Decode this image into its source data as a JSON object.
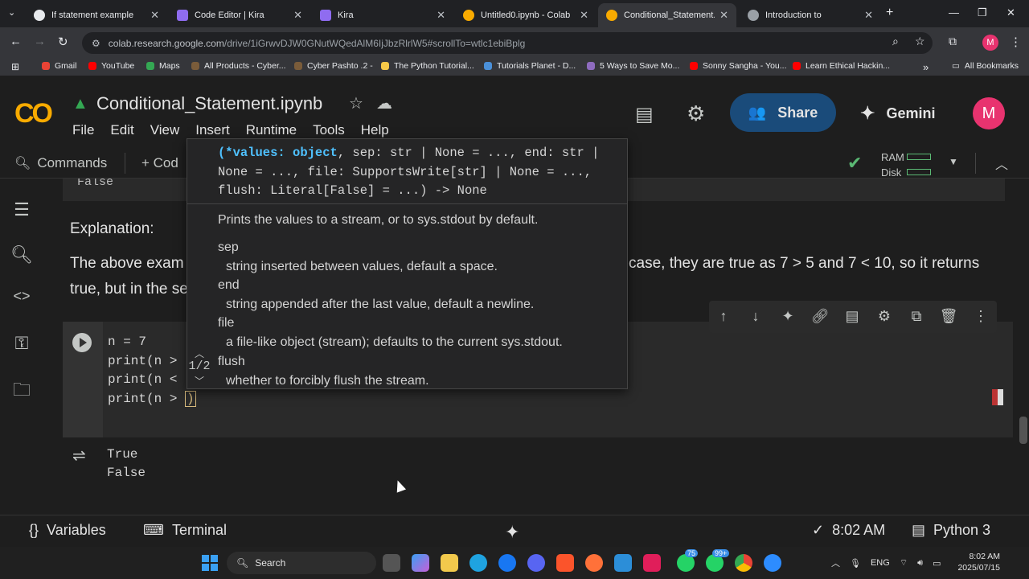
{
  "browser": {
    "tabs": [
      {
        "title": "If statement example",
        "icon": "chatgpt-icon",
        "color": "#e8eaed"
      },
      {
        "title": "Code Editor | Kira",
        "icon": "kira-icon",
        "color": "#8f6cf0"
      },
      {
        "title": "Kira",
        "icon": "kira-icon",
        "color": "#8f6cf0"
      },
      {
        "title": "Untitled0.ipynb - Colab",
        "icon": "colab-icon",
        "color": "#f9ab00"
      },
      {
        "title": "Conditional_Statement.ipyn",
        "icon": "colab-icon",
        "color": "#f9ab00"
      },
      {
        "title": "Introduction to",
        "icon": "globe-icon",
        "color": "#9aa0a6"
      }
    ],
    "new_tab": "+",
    "url_main": "colab.research.google.com",
    "url_tail": "/drive/1iGrwvDJW0GNutWQedAlM6IjJbzRlrlW5#scrollTo=wtlc1ebiBplg",
    "bookmarks": [
      {
        "label": "Gmail",
        "color": "#ea4335"
      },
      {
        "label": "YouTube",
        "color": "#ff0000"
      },
      {
        "label": "Maps",
        "color": "#34a853"
      },
      {
        "label": "All Products - Cyber...",
        "color": "#7a5c3a"
      },
      {
        "label": "Cyber Pashto .2 -",
        "color": "#7a5c3a"
      },
      {
        "label": "The Python Tutorial...",
        "color": "#f7c948"
      },
      {
        "label": "Tutorials Planet - D...",
        "color": "#4a90d9"
      },
      {
        "label": "5 Ways to Save Mo...",
        "color": "#8e6bbf"
      },
      {
        "label": "Sonny Sangha - You...",
        "color": "#ff0000"
      },
      {
        "label": "Learn Ethical Hackin...",
        "color": "#ff0000"
      }
    ],
    "bookmarks_more": "»",
    "all_bookmarks": "All Bookmarks"
  },
  "colab": {
    "logo": "CO",
    "notebook_title": "Conditional_Statement.ipynb",
    "menu": [
      "File",
      "Edit",
      "View",
      "Insert",
      "Runtime",
      "Tools",
      "Help"
    ],
    "share_label": "Share",
    "gemini_label": "Gemini",
    "avatar_letter": "M",
    "commands_label": "Commands",
    "add_code_label": "+ Cod",
    "ram_label": "RAM",
    "disk_label": "Disk"
  },
  "notebook": {
    "prev_output": "False",
    "explanation_heading": "Explanation:",
    "explanation_line1_start": "The above exam",
    "explanation_line1_end": "case, they are true as 7 > 5 and 7 < 10, so it returns",
    "explanation_line2": "true, but in the se",
    "code_lines": [
      "n = 7",
      "print(n >",
      "print(n <",
      "print(n > "
    ],
    "code_last_paren": ")",
    "output_lines": [
      "True",
      "False"
    ]
  },
  "tooltip": {
    "sig_line1_keyword": "(*values: object",
    "sig_line1_rest": ", sep: str | None = ..., end: str |",
    "sig_line2": "None = ..., file: SupportsWrite[str] | None = ...,",
    "sig_line3": "flush: Literal[False] = ...) -> None",
    "summary": "Prints the values to a stream, or to sys.stdout by default.",
    "params": [
      {
        "name": "sep",
        "desc": "string inserted between values, default a space."
      },
      {
        "name": "end",
        "desc": "string appended after the last value, default a newline."
      },
      {
        "name": "file",
        "desc": "a file-like object (stream); defaults to the current sys.stdout."
      },
      {
        "name": "flush",
        "desc": "whether to forcibly flush the stream."
      }
    ],
    "pager": "1/2"
  },
  "statusbar": {
    "variables_label": "Variables",
    "terminal_label": "Terminal",
    "time_label": "8:02 AM",
    "kernel_label": "Python 3"
  },
  "taskbar": {
    "search_label": "Search",
    "lang": "ENG",
    "time": "8:02 AM",
    "date": "2025/07/15",
    "badge1": "75",
    "badge2": "99+"
  }
}
